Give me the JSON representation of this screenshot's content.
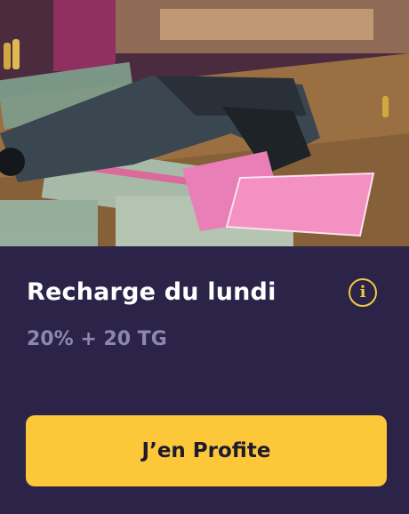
{
  "promo": {
    "title": "Recharge du lundi",
    "subtitle": "20% + 20 TG",
    "cta_label": "J’en Profite",
    "info_icon": "info-icon"
  },
  "colors": {
    "card_background": "#2b2448",
    "button_background": "#fcc83a",
    "accent": "#f6c744",
    "subtitle_text": "#8e87ad"
  }
}
